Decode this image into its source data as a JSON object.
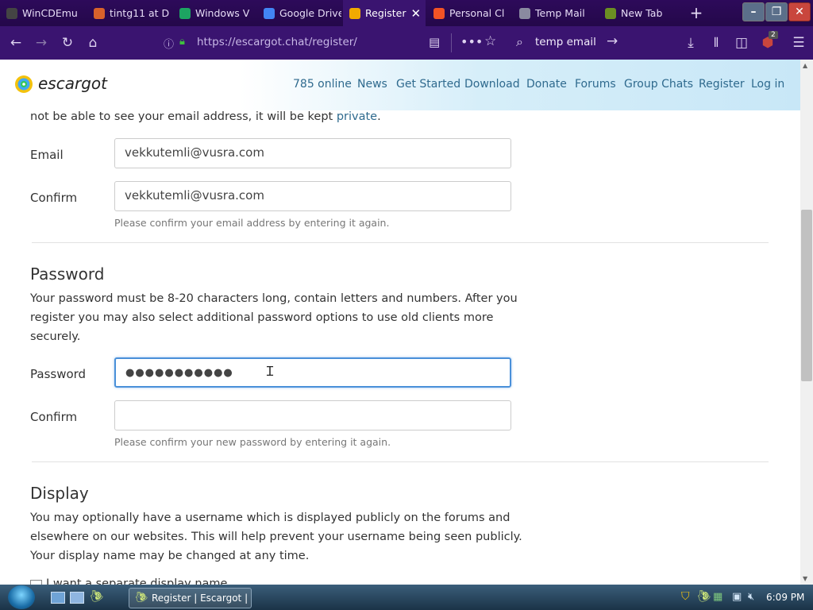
{
  "browser": {
    "tabs": [
      {
        "label": "WinCDEmu",
        "color": "#444"
      },
      {
        "label": "tintg11 at D",
        "color": "#d8622b"
      },
      {
        "label": "Windows V",
        "color": "#1da462"
      },
      {
        "label": "Google Drive - V",
        "color": "#4285f4"
      },
      {
        "label": "Register",
        "color": "#f2a900",
        "active": true
      },
      {
        "label": "Personal Cl",
        "color": "#f35325"
      },
      {
        "label": "Temp Mail",
        "color": "#8a8aa0"
      },
      {
        "label": "New Tab",
        "color": "#6b8e23"
      }
    ],
    "url": "https://escargot.chat/register/",
    "search_value": "temp email",
    "addon_badge": "2"
  },
  "site": {
    "logo_text": "escargot",
    "nav": [
      "785 online",
      "News",
      "Get Started",
      "Download",
      "Donate",
      "Forums",
      "Group Chats",
      "Register",
      "Log in"
    ]
  },
  "form": {
    "intro_text": "not be able to see your email address, it will be kept",
    "intro_link": "private",
    "intro_end": ".",
    "email_label": "Email",
    "email_value": "vekkutemli@vusra.com",
    "confirm_label": "Confirm",
    "confirm_email_value": "vekkutemli@vusra.com",
    "confirm_email_help": "Please confirm your email address by entering it again.",
    "password_heading": "Password",
    "password_desc_1": "Your password must be 8-20 characters long, contain letters and numbers. After you",
    "password_desc_2": "register you may also select additional password options to use old clients more",
    "password_desc_3": "securely.",
    "password_label": "Password",
    "password_value": "●●●●●●●●●●●",
    "confirm_password_label": "Confirm",
    "confirm_password_value": "",
    "confirm_password_help": "Please confirm your new password by entering it again.",
    "display_heading": "Display",
    "display_desc_1": "You may optionally have a username which is displayed publicly on the forums and",
    "display_desc_2": "elsewhere on our websites. This will help prevent your username being seen publicly.",
    "display_desc_3": "Your display name may be changed at any time.",
    "display_checkbox_label": "I want a separate display name"
  },
  "taskbar": {
    "task_label": "Register | Escargot | ...",
    "clock": "6:09 PM"
  },
  "colors": {
    "accent": "#4a90d9",
    "link": "#2f6a8e",
    "browser_bg": "#3a1470"
  }
}
